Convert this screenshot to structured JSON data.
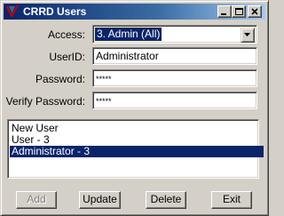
{
  "window": {
    "title": "CRRD Users",
    "app_icon": "crrd-logo-icon",
    "controls": [
      "minimize-icon",
      "maximize-icon",
      "close-icon"
    ]
  },
  "form": {
    "access": {
      "label": "Access:",
      "value": "3. Admin (All)"
    },
    "userid": {
      "label": "UserID:",
      "value": "Administrator"
    },
    "password": {
      "label": "Password:",
      "value": "*****"
    },
    "verify_password": {
      "label": "Verify Password:",
      "value": "*****"
    }
  },
  "users_list": {
    "items": [
      "New User",
      "User - 3",
      "Administrator - 3"
    ],
    "selected_index": 2
  },
  "buttons": {
    "add": {
      "label": "Add",
      "enabled": false
    },
    "update": {
      "label": "Update",
      "enabled": true
    },
    "delete": {
      "label": "Delete",
      "enabled": true
    },
    "exit": {
      "label": "Exit",
      "enabled": true
    }
  },
  "colors": {
    "face": "#d4d0c8",
    "titlebar_start": "#0a246a",
    "titlebar_end": "#a6caf0",
    "selection": "#0a246a",
    "logo_red": "#cc0000"
  }
}
